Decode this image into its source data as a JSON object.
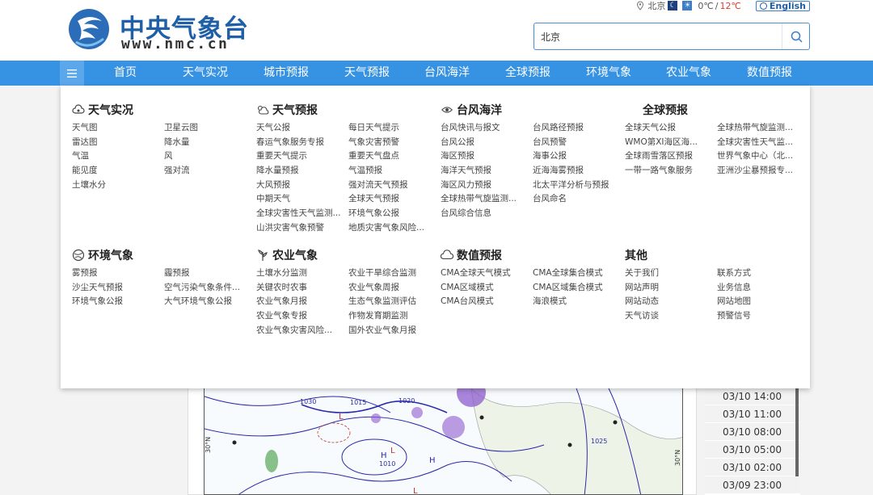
{
  "header": {
    "logo_title": "中央气象台",
    "logo_url": "www.nmc.cn",
    "location": "北京",
    "temp_min": "0℃",
    "temp_sep": "/",
    "temp_max": "12℃",
    "english_label": "English"
  },
  "search": {
    "value": "北京"
  },
  "nav": {
    "items": [
      "首页",
      "天气实况",
      "城市预报",
      "天气预报",
      "台风海洋",
      "全球预报",
      "环境气象",
      "农业气象",
      "数值预报"
    ]
  },
  "mega_menu": {
    "sections": [
      {
        "title": "天气实况",
        "icon": "cloud-weather-icon",
        "links": [
          "天气图",
          "卫星云图",
          "雷达图",
          "降水量",
          "气温",
          "风",
          "能见度",
          "强对流",
          "土壤水分"
        ]
      },
      {
        "title": "天气预报",
        "icon": "sun-cloud-icon",
        "links": [
          "天气公报",
          "每日天气提示",
          "春运气象服务专报",
          "气象灾害预警",
          "重要天气提示",
          "重要天气盘点",
          "降水量预报",
          "气温预报",
          "大风预报",
          "强对流天气预报",
          "中期天气",
          "全球天气预报",
          "全球灾害性天气监测...",
          "环境气象公报",
          "山洪灾害气象预警",
          "地质灾害气象风险..."
        ]
      },
      {
        "title": "台风海洋",
        "icon": "typhoon-icon",
        "links": [
          "台风快讯与报文",
          "台风路径预报",
          "台风公报",
          "台风预警",
          "海区预报",
          "海事公报",
          "海洋天气预报",
          "近海海雾预报",
          "海区风力预报",
          "北太平洋分析与预报",
          "全球热带气旋监测...",
          "台风命名",
          "台风综合信息"
        ]
      },
      {
        "title": "全球预报",
        "icon": "",
        "links": [
          "全球天气公报",
          "全球热带气旋监测...",
          "WMO第XI海区海...",
          "全球灾害性天气监...",
          "全球雨雪落区预报",
          "世界气象中心（北...",
          "一带一路气象服务",
          "亚洲沙尘暴预报专..."
        ]
      },
      {
        "title": "环境气象",
        "icon": "environment-icon",
        "links": [
          "雾预报",
          "霾预报",
          "沙尘天气预报",
          "空气污染气象条件...",
          "环境气象公报",
          "大气环境气象公报"
        ]
      },
      {
        "title": "农业气象",
        "icon": "agriculture-icon",
        "links": [
          "土壤水分监测",
          "农业干旱综合监测",
          "关键农时农事",
          "农业气象周报",
          "农业气象月报",
          "生态气象监测评估",
          "农业气象专报",
          "作物发育期监测",
          "农业气象灾害风险...",
          "国外农业气象月报"
        ]
      },
      {
        "title": "数值预报",
        "icon": "cloud-icon",
        "links": [
          "CMA全球天气模式",
          "CMA全球集合模式",
          "CMA区域模式",
          "CMA区域集合模式",
          "CMA台风模式",
          "海浪模式"
        ]
      },
      {
        "title": "其他",
        "icon": "",
        "links": [
          "关于我们",
          "联系方式",
          "网站声明",
          "业务信息",
          "网站动态",
          "网站地图",
          "天气访谈",
          "预警信号"
        ]
      }
    ]
  },
  "timeline": {
    "items": [
      "03/10 14:00",
      "03/10 11:00",
      "03/10 08:00",
      "03/10 05:00",
      "03/10 02:00",
      "03/09 23:00"
    ]
  },
  "map": {
    "label_lat": "30°N",
    "label_lat_right": "30°N",
    "isobars": [
      "1030",
      "1015",
      "1020",
      "1010",
      "1025"
    ],
    "highs": [
      "H",
      "H"
    ],
    "lows": [
      "L",
      "L",
      "L"
    ]
  },
  "colors": {
    "nav_bg": "#3692e2",
    "brand": "#1f5fa8",
    "temp_max": "#e23a2e"
  }
}
